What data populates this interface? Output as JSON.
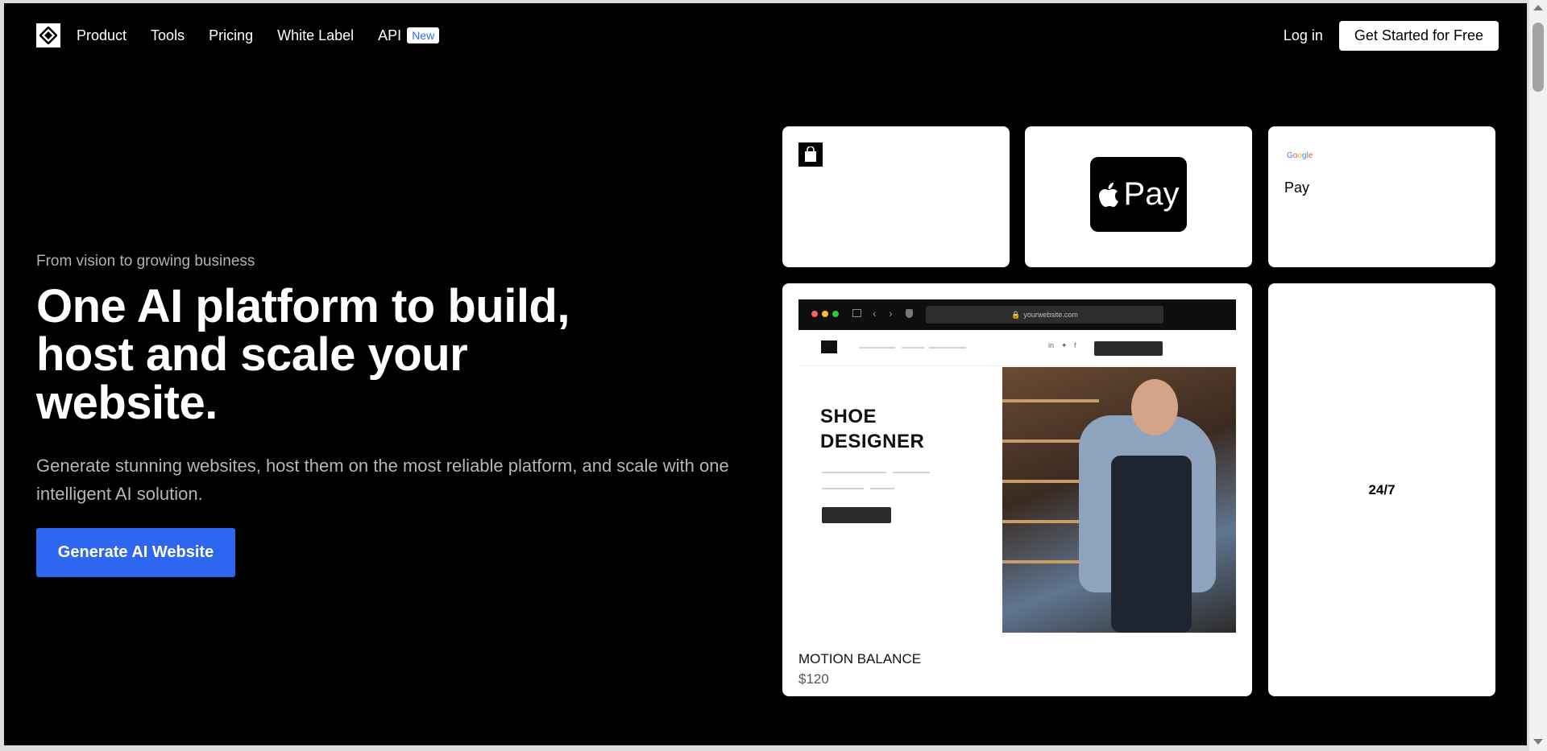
{
  "nav": {
    "items": [
      "Product",
      "Tools",
      "Pricing",
      "White Label"
    ],
    "api_label": "API",
    "api_badge": "New",
    "login": "Log in",
    "cta": "Get Started for Free"
  },
  "hero": {
    "eyebrow": "From vision to growing business",
    "headline": "One AI platform to build, host and scale your website.",
    "subtitle": "Generate stunning websites, host them on the most reliable platform, and scale with one intelligent AI solution.",
    "cta": "Generate AI Website"
  },
  "cards": {
    "apple_pay_label": "Pay",
    "google_label": "Google",
    "google_pay_label": "Pay",
    "browser_url": "yourwebsite.com",
    "shoe_title_line1": "SHOE",
    "shoe_title_line2": "DESIGNER",
    "product_name": "MOTION BALANCE",
    "product_price": "$120",
    "stat": "24/7"
  },
  "colors": {
    "accent": "#2f66ef",
    "background": "#000000",
    "card": "#ffffff"
  }
}
